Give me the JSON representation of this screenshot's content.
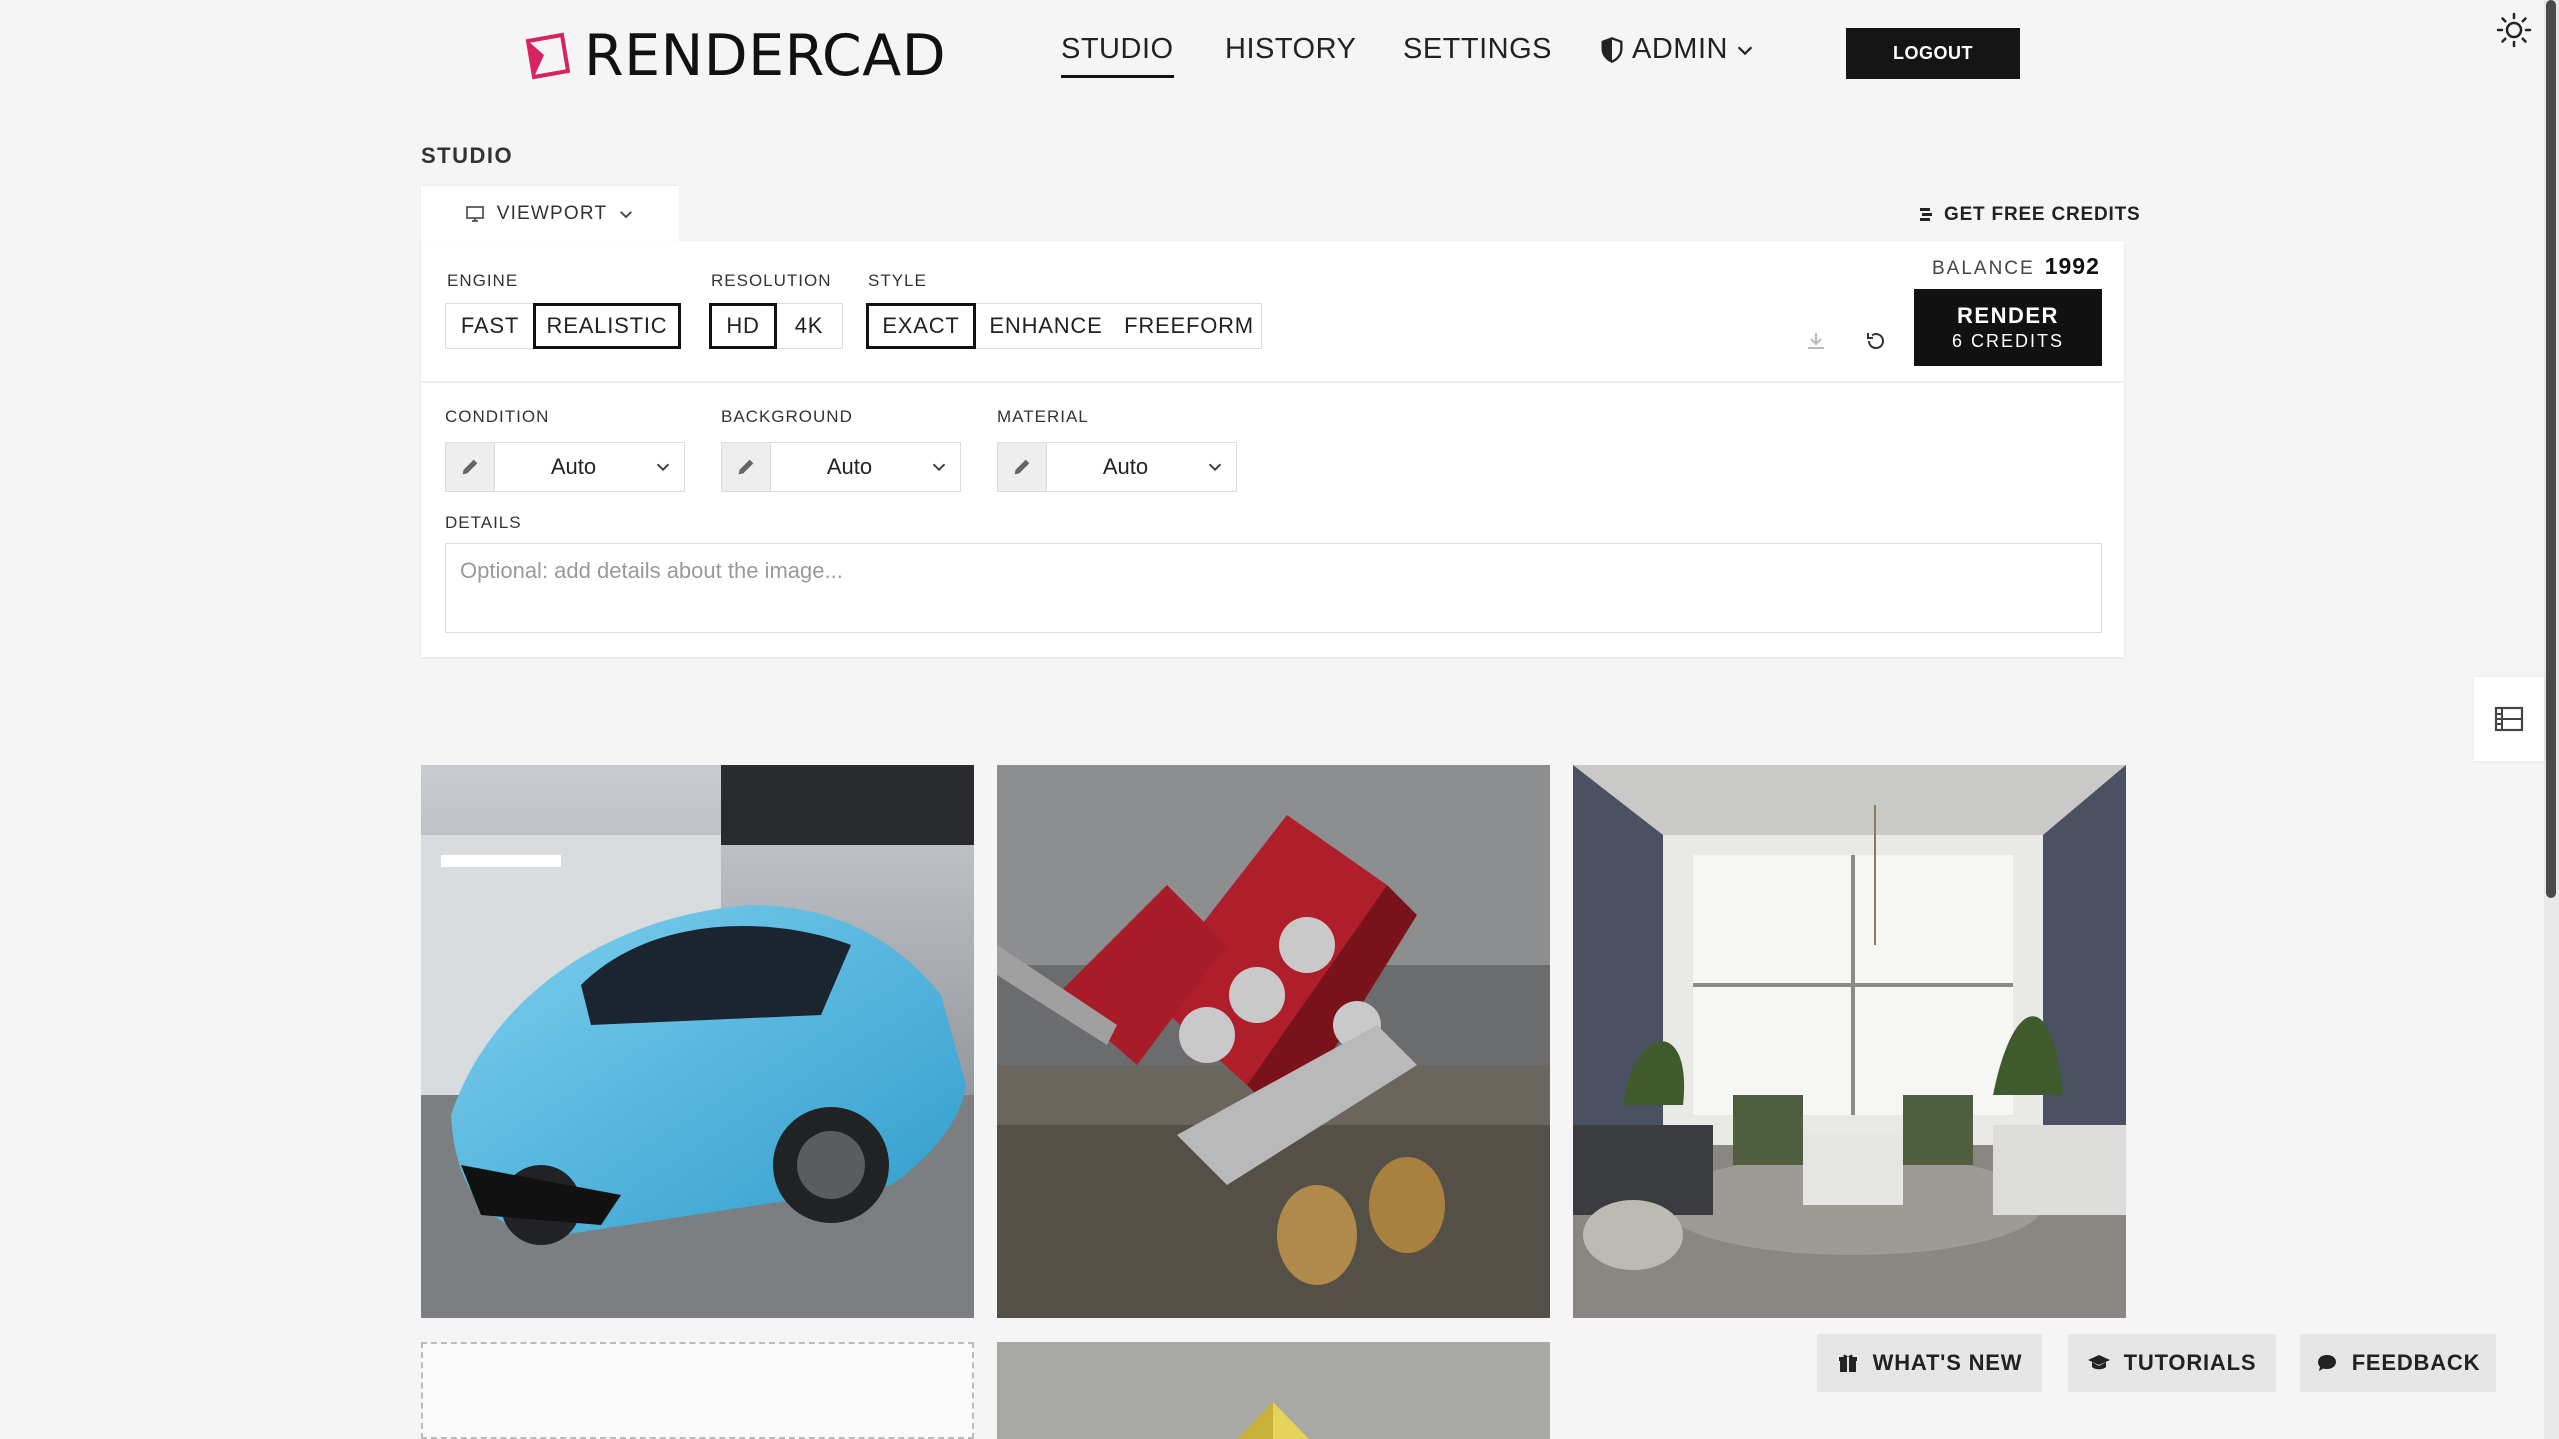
{
  "header": {
    "logo_text": "RENDERCAD",
    "nav": {
      "studio": "STUDIO",
      "history": "HISTORY",
      "settings": "SETTINGS",
      "admin": "ADMIN"
    },
    "logout_label": "LOGOUT"
  },
  "page": {
    "title": "STUDIO",
    "viewport_tab": "VIEWPORT",
    "free_credits": "GET FREE CREDITS"
  },
  "controls": {
    "engine": {
      "label": "ENGINE",
      "options": [
        "FAST",
        "REALISTIC"
      ],
      "selected": "REALISTIC"
    },
    "resolution": {
      "label": "RESOLUTION",
      "options": [
        "HD",
        "4K"
      ],
      "selected": "HD"
    },
    "style": {
      "label": "STYLE",
      "options": [
        "EXACT",
        "ENHANCE",
        "FREEFORM"
      ],
      "selected": "EXACT"
    },
    "balance_label": "BALANCE",
    "balance_value": "1992",
    "render_label": "RENDER",
    "render_cost": "6 CREDITS",
    "condition": {
      "label": "CONDITION",
      "value": "Auto"
    },
    "background": {
      "label": "BACKGROUND",
      "value": "Auto"
    },
    "material": {
      "label": "MATERIAL",
      "value": "Auto"
    },
    "details": {
      "label": "DETAILS",
      "placeholder": "Optional: add details about the image..."
    }
  },
  "footer_buttons": {
    "whats_new": "WHAT'S NEW",
    "tutorials": "TUTORIALS",
    "feedback": "FEEDBACK"
  },
  "icons": [
    "logo-icon",
    "shield-icon",
    "chevron-down-icon",
    "sun-icon",
    "monitor-icon",
    "coins-icon",
    "download-icon",
    "reset-icon",
    "pencil-icon",
    "film-icon",
    "gift-icon",
    "graduation-cap-icon",
    "chat-bubble-icon"
  ],
  "colors": {
    "brand": "#d6245e",
    "primary": "#111111"
  }
}
